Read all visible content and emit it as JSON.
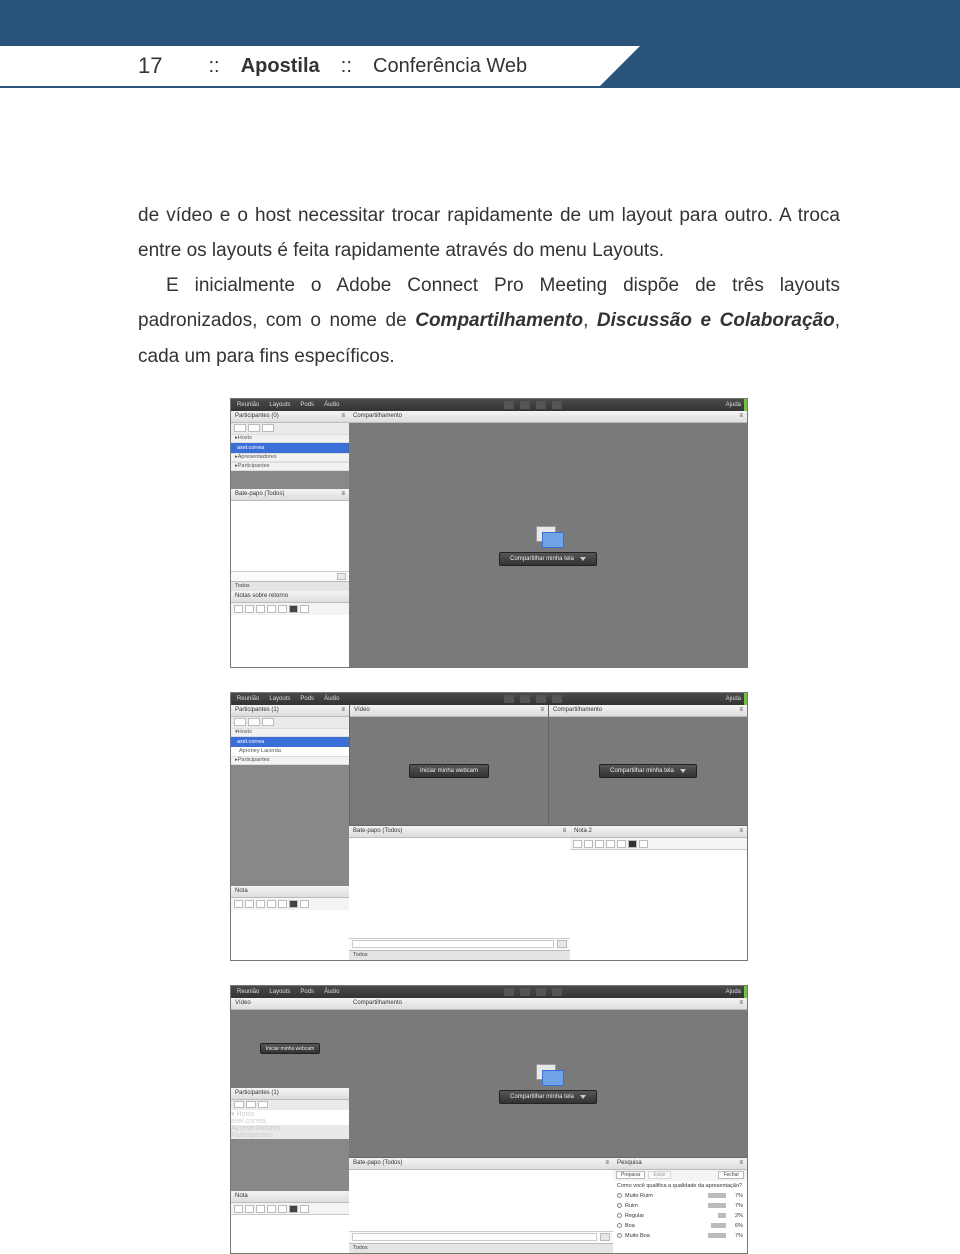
{
  "page_number": "17",
  "breadcrumb": {
    "sep": "::",
    "apostila": "Apostila",
    "section": "Conferência Web"
  },
  "body": {
    "p1": "de vídeo e o host necessitar trocar rapidamente de um layout para outro. A troca entre os layouts é feita rapidamente através do menu Layouts.",
    "p2a": "E inicialmente o Adobe Connect Pro Meeting dispõe de três layouts padronizados, com o nome de ",
    "p2_em1": "Compartilhamento",
    "p2_mid1": ", ",
    "p2_em2": "Discussão e Colaboração",
    "p2b": ", cada um para fins específicos."
  },
  "menus": {
    "reuniao": "Reunião",
    "layouts": "Layouts",
    "pods": "Pods",
    "audio": "Áudio",
    "ajuda": "Ajuda"
  },
  "panels": {
    "participantes": "Participantes",
    "participantes_count1": "(0)",
    "participantes_count2": "(1)",
    "compartilhamento": "Compartilhamento",
    "batepapo": "Bate-papo",
    "batepapo_todos_paren": "(Todos)",
    "batepapo_todos_tab": "Todos",
    "notas": "Nota",
    "notas_retorno": "Notas sobre retorno",
    "nota2": "Nota 2",
    "video": "Vídeo",
    "pesquisa": "Pesquisa"
  },
  "groups": {
    "hosts": "Hosts",
    "apresentadores": "Apresentadores",
    "participantes": "Participantes"
  },
  "user": "axel.correa",
  "user2": "Aproney Lacerda",
  "buttons": {
    "compartilhar_tela": "Compartilhar minha tela",
    "iniciar_webcam": "Iniciar minha webcam",
    "preparar": "Preparar",
    "exibir": "Exibir",
    "fechar": "Fechar"
  },
  "poll": {
    "question": "Como você qualifica a qualidade da apresentação?",
    "options": [
      {
        "label": "Muito Ruim",
        "pct": "7%"
      },
      {
        "label": "Ruim",
        "pct": "7%"
      },
      {
        "label": "Regular",
        "pct": "2%"
      },
      {
        "label": "Boa",
        "pct": "6%"
      },
      {
        "label": "Muito Boa",
        "pct": "7%"
      }
    ]
  }
}
